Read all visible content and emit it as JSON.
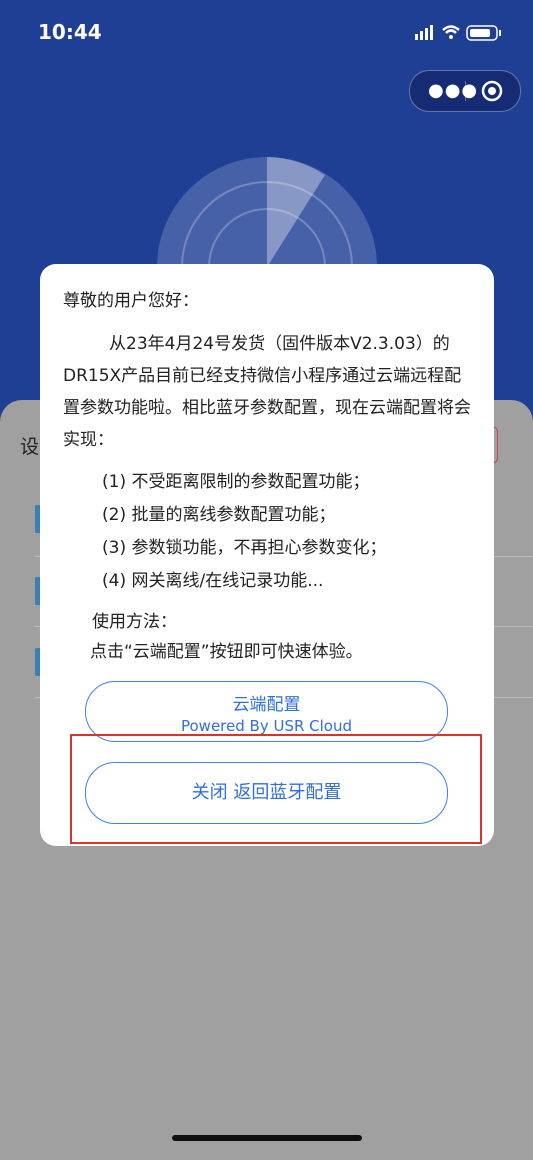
{
  "status_bar": {
    "time": "10:44"
  },
  "background": {
    "partial_label": "设"
  },
  "modal": {
    "greeting": "尊敬的用户您好：",
    "paragraph": "从23年4月24号发货（固件版本V2.3.03）的DR15X产品目前已经支持微信小程序通过云端远程配置参数功能啦。相比蓝牙参数配置，现在云端配置将会实现：",
    "features": [
      "(1) 不受距离限制的参数配置功能；",
      "(2) 批量的离线参数配置功能；",
      "(3) 参数锁功能，不再担心参数变化；",
      "(4) 网关离线/在线记录功能..."
    ],
    "usage_title": "使用方法：",
    "usage_text": "点击“云端配置”按钮即可快速体验。",
    "cloud_button": {
      "label": "云端配置",
      "sub_label": "Powered By USR Cloud"
    },
    "close_button": {
      "label": "关闭 返回蓝牙配置"
    }
  },
  "colors": {
    "header": "#1f3f95",
    "accent": "#2f6fe0",
    "highlight": "#d9332c"
  }
}
